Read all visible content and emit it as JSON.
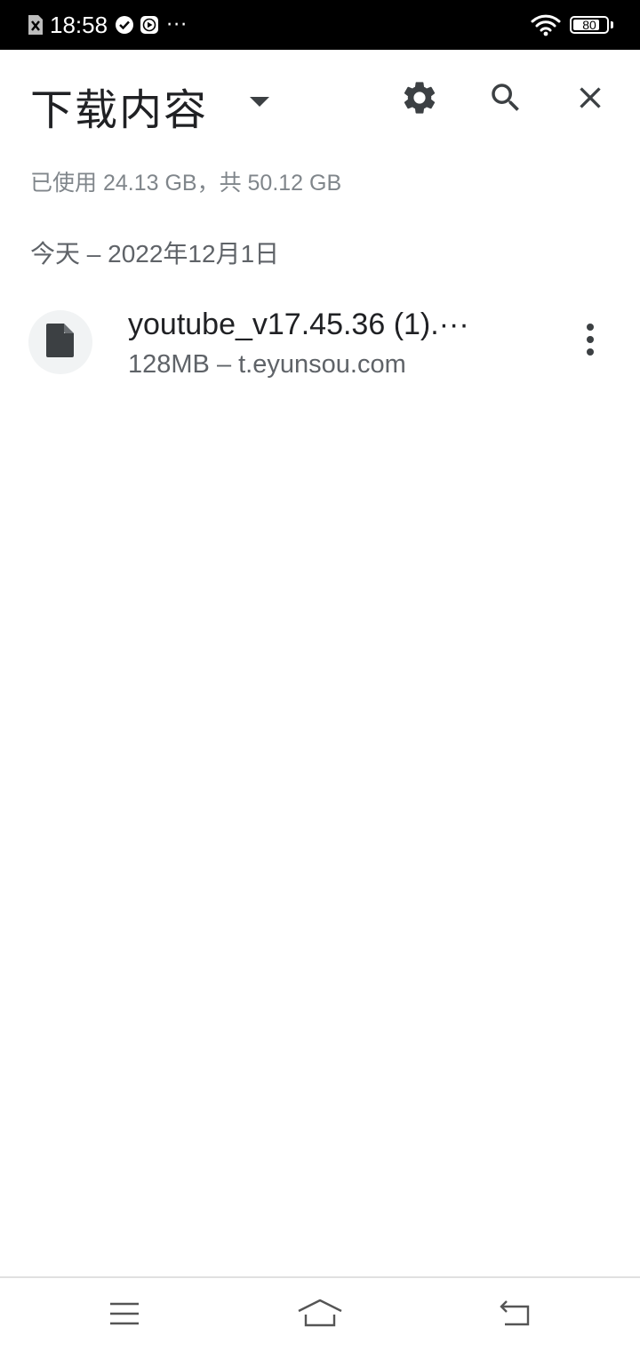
{
  "status_bar": {
    "time": "18:58",
    "more_indicator": "···",
    "battery_level": "80",
    "battery_fraction": 0.8,
    "icons": [
      "sim-error-icon",
      "check-circle-icon",
      "play-icon",
      "wifi-icon",
      "battery-icon"
    ]
  },
  "header": {
    "title": "下载内容",
    "icons": [
      "dropdown-arrow-icon",
      "settings-gear-icon",
      "search-icon",
      "close-icon"
    ]
  },
  "storage": {
    "text": "已使用 24.13 GB，共 50.12 GB"
  },
  "sections": [
    {
      "date_label": "今天 – 2022年12月1日",
      "items": [
        {
          "name": "youtube_v17.45.36 (1).···",
          "meta": "128MB – t.eyunsou.com",
          "icon": "file-icon"
        }
      ]
    }
  ],
  "nav_bar": {
    "icons": [
      "menu-icon",
      "home-icon",
      "back-icon"
    ]
  },
  "colors": {
    "status_bg": "#000000",
    "text_primary": "#202124",
    "text_secondary": "#5f6368",
    "text_tertiary": "#80868b",
    "icon_bg": "#f1f3f4",
    "icon_dark": "#3c4043"
  }
}
